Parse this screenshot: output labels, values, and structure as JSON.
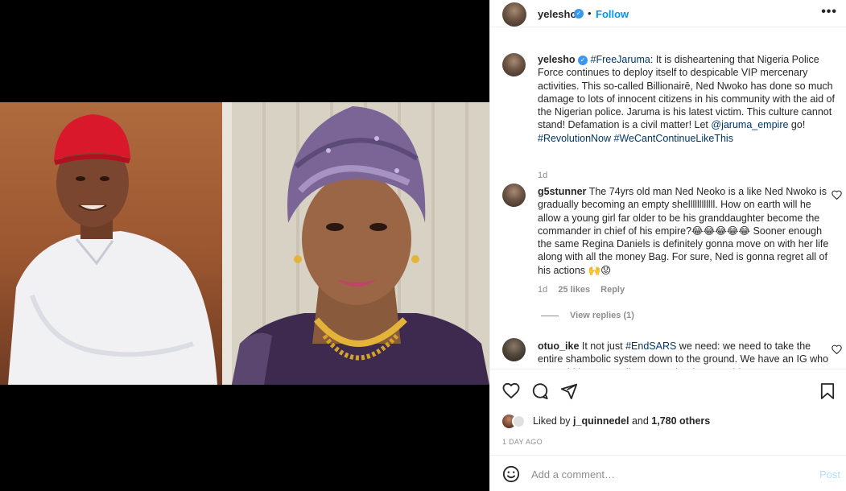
{
  "post": {
    "username": "yelesho",
    "follow_label": "Follow",
    "dot": "•",
    "more": "•••",
    "verified_glyph": "✓"
  },
  "caption": {
    "username": "yelesho",
    "hashtag_open": "#FreeJaruma",
    "body": ": It is disheartening that Nigeria Police Force continues to deploy itself to despicable VIP mercenary activities. This so-called Billionairē, Ned Nwoko has done so much damage to lots of innocent citizens in his community with the aid of the Nigerian police. Jaruma is his latest victim. This culture cannot stand! Defamation is a civil matter! Let ",
    "mention": "@jaruma_empire",
    "body_end": " go!",
    "hashtags_end": "#RevolutionNow #WeCantContinueLikeThis",
    "time": "1d"
  },
  "comments": [
    {
      "username": "g5stunner",
      "text": "The 74yrs old man Ned Neoko is a like Ned Nwoko is gradually becoming an empty shellllllllllll. How on earth will he allow a young girl far older to be his granddaughter become the commander in chief of his empire?😂😂😂😂😂 Sooner enough the same Regina Daniels is definitely gonna move on with her life along with all the money Bag. For sure, Ned is gonna regret all of his actions 🙌😟",
      "time": "1d",
      "likes": "25 likes",
      "reply": "Reply",
      "view_replies": "View replies (1)"
    },
    {
      "username": "otuo_ike",
      "text_pre": "It not just ",
      "hashtag": "#EndSARS",
      "text_post": " we need: we need to take the entire shambolic system down to the ground. We have an IG who ... would be responding to another issue ... this"
    }
  ],
  "likes": {
    "prefix": "Liked by ",
    "user": "j_quinnedel",
    "middle": " and ",
    "count": "1,780 others"
  },
  "time_ago": "1 DAY AGO",
  "add_comment": {
    "placeholder": "Add a comment…",
    "post_label": "Post"
  },
  "icons": {
    "like": "heart-icon",
    "comment": "comment-icon",
    "share": "share-icon",
    "save": "bookmark-icon",
    "emoji": "emoji-icon"
  },
  "colors": {
    "accent": "#0095f6",
    "verified": "#3897f0",
    "muted": "#8e8e8e",
    "link": "#00376b"
  }
}
